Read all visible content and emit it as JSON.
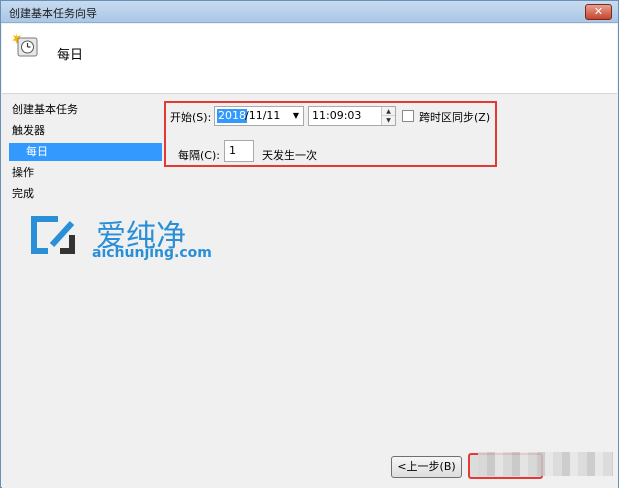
{
  "window": {
    "title": "创建基本任务向导",
    "close_glyph": "✕"
  },
  "header": {
    "title": "每日",
    "icon": "task-clock-icon"
  },
  "sidebar": {
    "items": [
      {
        "label": "创建基本任务",
        "selected": false
      },
      {
        "label": "触发器",
        "selected": false
      },
      {
        "label": "每日",
        "selected": true
      },
      {
        "label": "操作",
        "selected": false
      },
      {
        "label": "完成",
        "selected": false
      }
    ]
  },
  "form": {
    "start_label": "开始(S):",
    "date_selected": "2018",
    "date_rest": "/11/11",
    "date_dropdown_glyph": "▼",
    "time_value": "11:09:03",
    "timezone_sync_label": "跨时区同步(Z)",
    "timezone_sync_checked": false,
    "recur_label": "每隔(C):",
    "recur_value": "1",
    "recur_suffix": "天发生一次"
  },
  "watermark": {
    "title": "爱纯净",
    "url": "aichunjing.com"
  },
  "footer": {
    "back_label": "<上一步(B)",
    "next_label": "下一步(N)"
  },
  "colors": {
    "accent": "#3399ff",
    "highlight": "#e53935",
    "watermark": "#2a8fd7"
  }
}
